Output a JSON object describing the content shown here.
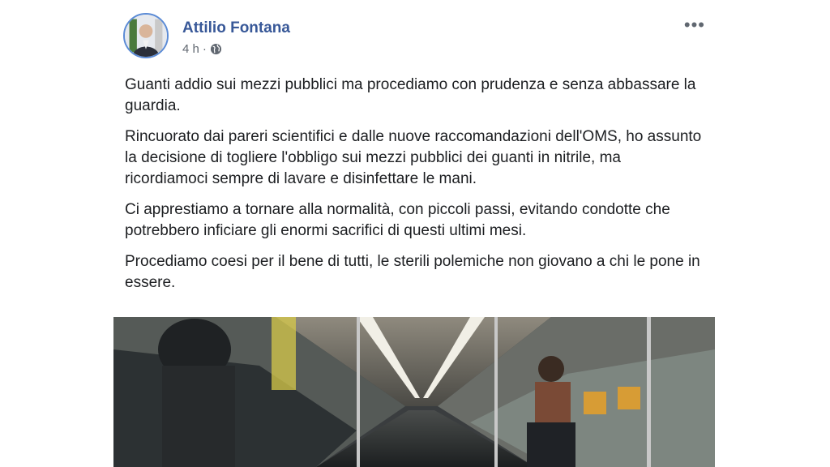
{
  "post": {
    "author": "Attilio Fontana",
    "time": "4 h",
    "separator": "·",
    "more_label": "•••",
    "paragraphs": [
      "Guanti addio sui mezzi pubblici ma procediamo con prudenza e senza abbassare la guardia.",
      "Rincuorato dai pareri scientifici e dalle nuove raccomandazioni dell'OMS, ho assunto la decisione di togliere l'obbligo sui mezzi pubblici dei guanti in nitrile, ma ricordiamoci sempre di lavare e disinfettare le mani.",
      "Ci apprestiamo a tornare alla normalità, con piccoli passi, evitando condotte che potrebbero inficiare gli enormi sacrifici di questi ultimi mesi.",
      "Procediamo coesi per il bene di tutti, le sterili polemiche non giovano a chi le pone in essere."
    ]
  },
  "colors": {
    "author": "#385898",
    "meta": "#606770",
    "avatar_ring": "#5b8bd6",
    "text": "#1c1e21"
  },
  "icons": {
    "globe": "globe-icon",
    "more": "more-options-icon"
  }
}
